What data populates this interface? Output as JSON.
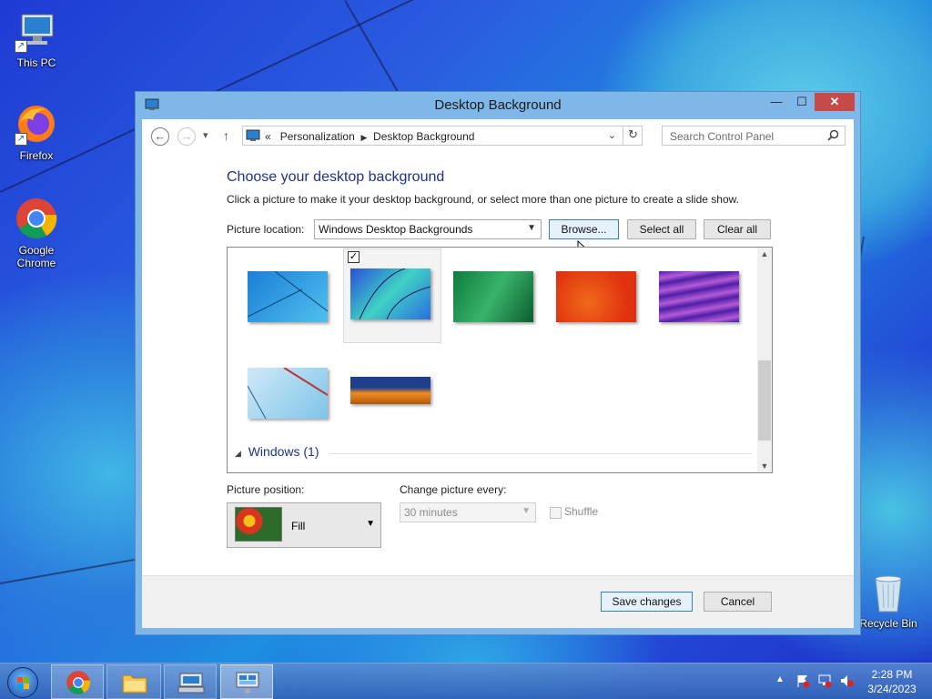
{
  "desktop": {
    "icons": [
      {
        "label": "This PC"
      },
      {
        "label": "Firefox"
      },
      {
        "label": "Google Chrome"
      },
      {
        "label": "Recycle Bin"
      }
    ]
  },
  "window": {
    "title": "Desktop Background",
    "controls": {
      "minimize": "—",
      "maximize": "☐",
      "close": "✕"
    },
    "nav": {
      "back": "←",
      "forward": "→",
      "dropdown": "▾",
      "up": "↑",
      "crumb_prefix": "«",
      "breadcrumbs": [
        "Personalization",
        "Desktop Background"
      ],
      "search_placeholder": "Search Control Panel"
    },
    "heading": "Choose your desktop background",
    "subtext": "Click a picture to make it your desktop background, or select more than one picture to create a slide show.",
    "picture_location_label": "Picture location:",
    "picture_location_value": "Windows Desktop Backgrounds",
    "buttons": {
      "browse": "Browse...",
      "select_all": "Select all",
      "clear_all": "Clear all"
    },
    "thumbnails": [
      {
        "name": "blue-lines",
        "selected": false,
        "colors": [
          "#1b7fd6",
          "#4fc0ee"
        ]
      },
      {
        "name": "blue-balloon",
        "selected": true,
        "colors": [
          "#2a4fd9",
          "#3fd1c4"
        ]
      },
      {
        "name": "green",
        "selected": false,
        "colors": [
          "#0e7b3c",
          "#39b36a"
        ]
      },
      {
        "name": "orange-red",
        "selected": false,
        "colors": [
          "#e0320f",
          "#f06a1a"
        ]
      },
      {
        "name": "purple",
        "selected": false,
        "colors": [
          "#4e1fa6",
          "#b45ad8"
        ]
      },
      {
        "name": "light-blue-paper",
        "selected": false,
        "colors": [
          "#7fc4e8",
          "#cfe9f7"
        ]
      },
      {
        "name": "orange-strip",
        "selected": false,
        "colors": [
          "#1f3f8c",
          "#f28a1d"
        ]
      }
    ],
    "group_label": "Windows (1)",
    "picture_position_label": "Picture position:",
    "picture_position_value": "Fill",
    "change_every_label": "Change picture every:",
    "change_every_value": "30 minutes",
    "shuffle_label": "Shuffle",
    "save_label": "Save changes",
    "cancel_label": "Cancel"
  },
  "taskbar": {
    "time": "2:28 PM",
    "date": "3/24/2023"
  },
  "colors": {
    "accent": "#1e3287",
    "titlebar": "#7fb8e8",
    "close_button": "#c74a4a",
    "taskbar": "#3e74c4"
  }
}
